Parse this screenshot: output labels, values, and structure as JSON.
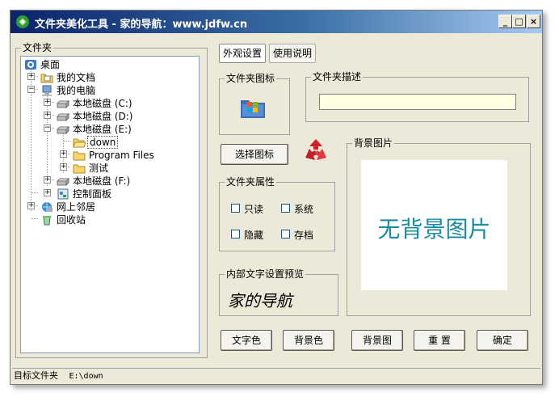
{
  "window": {
    "title": "文件夹美化工具 - 家的导航：www.jdfw.cn"
  },
  "folder_panel": {
    "label": "文件夹",
    "tree": [
      {
        "label": "桌面",
        "icon": "desktop-icon"
      },
      {
        "label": "我的文档",
        "icon": "folder-docs-icon"
      },
      {
        "label": "我的电脑",
        "icon": "computer-icon"
      },
      {
        "label": "本地磁盘 (C:)",
        "icon": "drive-icon"
      },
      {
        "label": "本地磁盘 (D:)",
        "icon": "drive-icon"
      },
      {
        "label": "本地磁盘 (E:)",
        "icon": "drive-icon"
      },
      {
        "label": "down",
        "icon": "folder-open-icon",
        "selected": true
      },
      {
        "label": "Program Files",
        "icon": "folder-icon"
      },
      {
        "label": "测试",
        "icon": "folder-icon"
      },
      {
        "label": "本地磁盘 (F:)",
        "icon": "drive-icon"
      },
      {
        "label": "控制面板",
        "icon": "control-panel-icon"
      },
      {
        "label": "网上邻居",
        "icon": "network-icon"
      },
      {
        "label": "回收站",
        "icon": "recycle-bin-icon"
      }
    ]
  },
  "tabs": [
    {
      "label": "外观设置",
      "active": true
    },
    {
      "label": "使用说明",
      "active": false
    }
  ],
  "folder_icon": {
    "label": "文件夹图标"
  },
  "folder_desc": {
    "label": "文件夹描述",
    "value": ""
  },
  "select_icon_button": "选择图标",
  "folder_attrs": {
    "label": "文件夹属性",
    "items": [
      {
        "label": "只读",
        "checked": false
      },
      {
        "label": "系统",
        "checked": false
      },
      {
        "label": "隐藏",
        "checked": false
      },
      {
        "label": "存档",
        "checked": false
      }
    ]
  },
  "preview": {
    "label": "内部文字设置预览",
    "text": "家的导航"
  },
  "background": {
    "label": "背景图片",
    "placeholder_text": "无背景图片"
  },
  "buttons": {
    "text_color": "文字色",
    "bg_color": "背景色",
    "bg_image": "背景图",
    "reset": "重 置",
    "ok": "确定"
  },
  "status": {
    "label": "目标文件夹",
    "value": "E:\\down"
  },
  "colors": {
    "title_start": "#0a246a",
    "title_end": "#a6caf0",
    "window_bg": "#ece9d8",
    "selected": "#316ac5",
    "placeholder_text": "#1a8aa0",
    "desc_field": "#ffffe1"
  }
}
